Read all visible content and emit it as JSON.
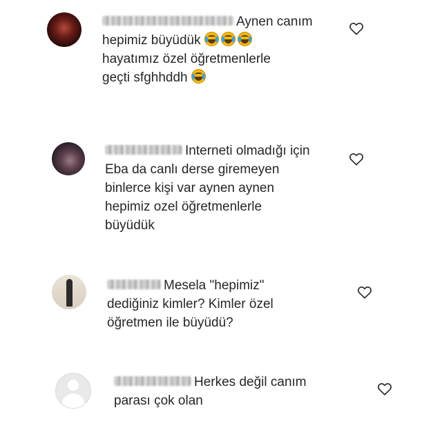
{
  "comments": [
    {
      "username": "",
      "lines": [
        "Aynen canım",
        "hepimiz büyüdük",
        "hayatımız özel öğretmenlerle",
        "geçti sfghhddh"
      ],
      "emoji_after_line2": [
        "face-with-tears-of-joy",
        "face-with-tears-of-joy",
        "face-with-tears-of-joy"
      ],
      "emoji_after_line4": [
        "face-with-tears-of-joy"
      ]
    },
    {
      "username": "",
      "text": "Interneti olmadığı için\nEba da canlı derse giremeyen\nbinlerce kişi var aynen aynen\nhepimiz ozel öğretmenlerle\nbüyüdük"
    },
    {
      "username": "",
      "text": "Mesela \"hepimiz\"\ndediğiniz kimler? Kimler özel\nöğretmen ile büyüdü?"
    },
    {
      "username": "",
      "text": "Herkes değil canım\nparası çok olan"
    }
  ],
  "icons": {
    "like": "heart-outline-icon",
    "avatar_default": "default-avatar-icon"
  },
  "colors": {
    "text": "#262626",
    "heart_stroke": "#262626",
    "emoji": "#f2b915"
  }
}
